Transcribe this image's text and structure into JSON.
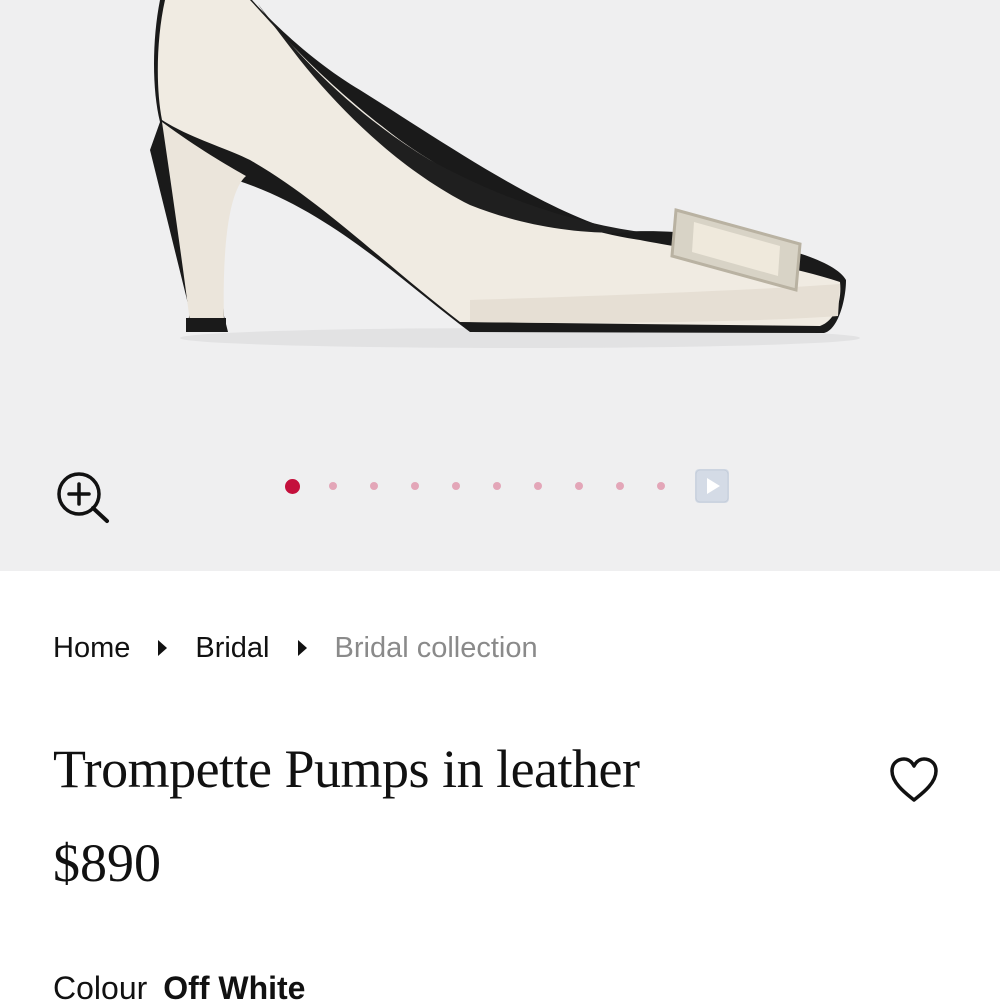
{
  "gallery": {
    "image_count": 10,
    "active_index": 0,
    "zoom_icon": "zoom-in-icon",
    "play_icon": "play-icon",
    "colors": {
      "background": "#efeff0",
      "dot_active": "#c4103c",
      "dot_inactive": "#e3a6b8"
    }
  },
  "breadcrumb": {
    "items": [
      {
        "label": "Home"
      },
      {
        "label": "Bridal"
      },
      {
        "label": "Bridal collection"
      }
    ],
    "separator_icon": "caret-right-icon"
  },
  "product": {
    "title": "Trompette Pumps in leather",
    "price": "$890",
    "wishlist_icon": "heart-icon",
    "colour_label": "Colour",
    "colour_value": "Off White"
  }
}
